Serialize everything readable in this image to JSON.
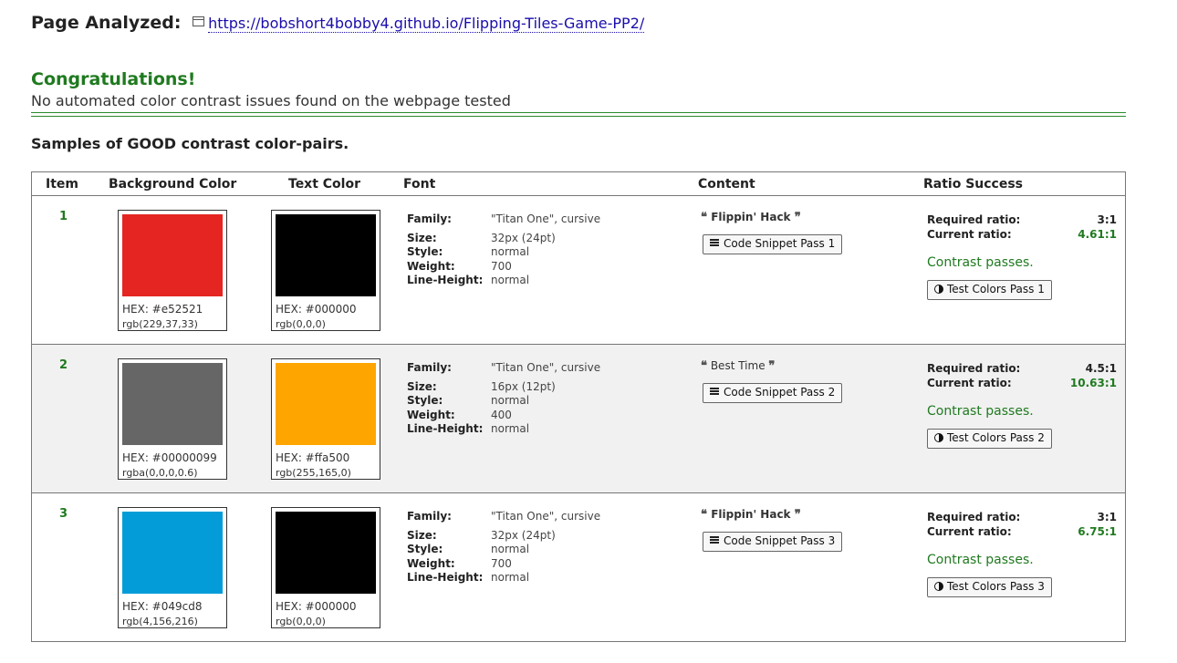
{
  "header": {
    "label": "Page Analyzed:",
    "url": "https://bobshort4bobby4.github.io/Flipping-Tiles-Game-PP2/"
  },
  "result": {
    "title": "Congratulations!",
    "message": "No automated color contrast issues found on the webpage tested"
  },
  "samples_title": "Samples of GOOD contrast color-pairs.",
  "table": {
    "columns": [
      "Item",
      "Background Color",
      "Text Color",
      "Font",
      "Content",
      "Ratio Success"
    ],
    "font_labels": {
      "family": "Family:",
      "size": "Size:",
      "style": "Style:",
      "weight": "Weight:",
      "line_height": "Line-Height:"
    },
    "ratio_labels": {
      "required": "Required ratio:",
      "current": "Current ratio:"
    },
    "rows": [
      {
        "item": "1",
        "bg": {
          "color": "#e52521",
          "hex": "HEX: #e52521",
          "rgb": "rgb(229,37,33)"
        },
        "text": {
          "color": "#000000",
          "hex": "HEX: #000000",
          "rgb": "rgb(0,0,0)"
        },
        "font": {
          "family": "\"Titan One\", cursive",
          "size": "32px (24pt)",
          "style": "normal",
          "weight": "700",
          "line_height": "normal"
        },
        "content": "Flippin' Hack",
        "snippet_button": "Code Snippet Pass 1",
        "required_ratio": "3:1",
        "current_ratio": "4.61:1",
        "status": "Contrast passes.",
        "test_button": "Test Colors Pass 1"
      },
      {
        "item": "2",
        "bg": {
          "color": "#666666",
          "hex": "HEX: #00000099",
          "rgb": "rgba(0,0,0,0.6)"
        },
        "text": {
          "color": "#ffa500",
          "hex": "HEX: #ffa500",
          "rgb": "rgb(255,165,0)"
        },
        "font": {
          "family": "\"Titan One\", cursive",
          "size": "16px (12pt)",
          "style": "normal",
          "weight": "400",
          "line_height": "normal"
        },
        "content": "Best Time",
        "snippet_button": "Code Snippet Pass 2",
        "required_ratio": "4.5:1",
        "current_ratio": "10.63:1",
        "status": "Contrast passes.",
        "test_button": "Test Colors Pass 2"
      },
      {
        "item": "3",
        "bg": {
          "color": "#049cd8",
          "hex": "HEX: #049cd8",
          "rgb": "rgb(4,156,216)"
        },
        "text": {
          "color": "#000000",
          "hex": "HEX: #000000",
          "rgb": "rgb(0,0,0)"
        },
        "font": {
          "family": "\"Titan One\", cursive",
          "size": "32px (24pt)",
          "style": "normal",
          "weight": "700",
          "line_height": "normal"
        },
        "content": "Flippin' Hack",
        "snippet_button": "Code Snippet Pass 3",
        "required_ratio": "3:1",
        "current_ratio": "6.75:1",
        "status": "Contrast passes.",
        "test_button": "Test Colors Pass 3"
      }
    ]
  }
}
